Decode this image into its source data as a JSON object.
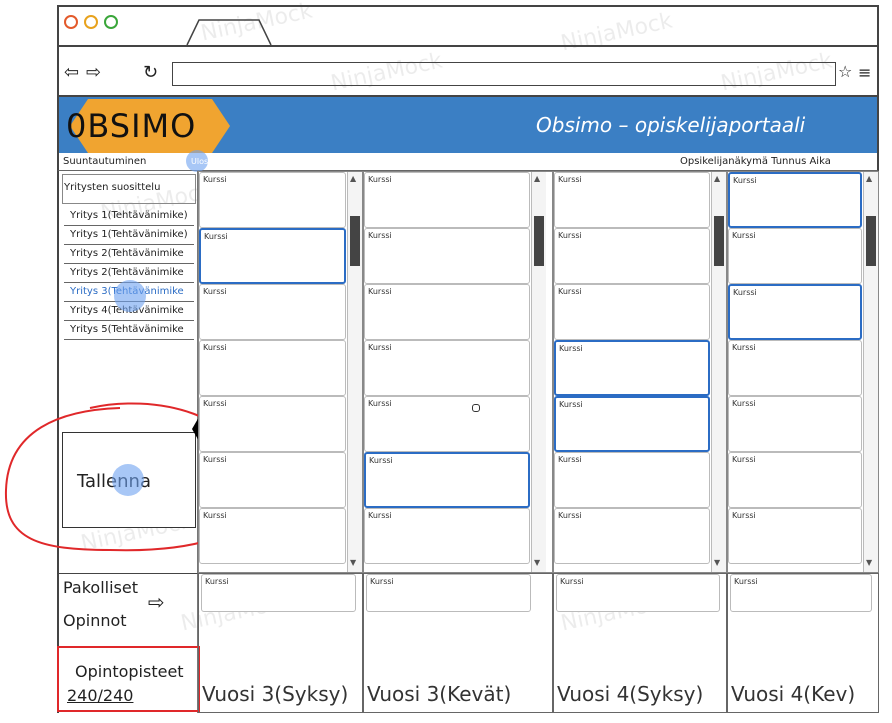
{
  "browser": {
    "tab_title": "",
    "url": ""
  },
  "header": {
    "logo": "0BSIMO",
    "title": "Obsimo – opiskelijaportaali",
    "bar_color": "#3b7fc4",
    "logo_color": "#f0a430"
  },
  "nav": {
    "orientation": "Suuntautuminen",
    "logout": "Ulos",
    "user_info": "Opsikelijanäkymä Tunnus Aika"
  },
  "sidebar": {
    "heading": "Yritysten suosittelu",
    "items": [
      "Yritys 1(Tehtävänimike)",
      "Yritys 1(Tehtävänimike)",
      "Yritys 2(Tehtävänimike",
      "Yritys 2(Tehtävänimike",
      "Yritys 3(Tehtävänimike",
      "Yritys 4(Tehtävänimike",
      "Yritys 5(Tehtävänimike"
    ],
    "save_label": "Tallenna",
    "required_line1": "Pakolliset",
    "required_line2": "Opinnot",
    "credits_label": "Opintopisteet",
    "credits_value": "240/240"
  },
  "course_label": "Kurssi",
  "columns": [
    {
      "year_label": "Vuosi 3(Syksy)"
    },
    {
      "year_label": "Vuosi 3(Kevät)"
    },
    {
      "year_label": "Vuosi 4(Syksy)"
    },
    {
      "year_label": "Vuosi 4(Kev)"
    }
  ],
  "watermark": "NinjaMock",
  "colors": {
    "selected": "#2b6cc4",
    "annotation": "#e0282a",
    "arrow": "#000000"
  }
}
